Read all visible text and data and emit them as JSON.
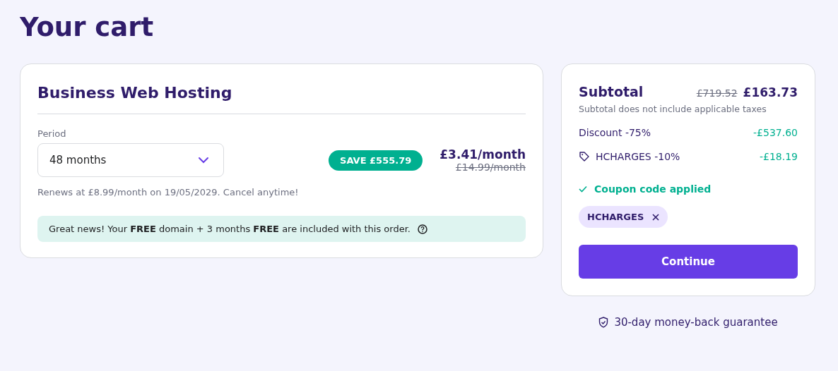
{
  "page_title": "Your cart",
  "product": {
    "name": "Business Web Hosting",
    "period_label": "Period",
    "period_value": "48 months",
    "save_badge": "SAVE £555.79",
    "price": "£3.41/month",
    "old_price": "£14.99/month",
    "renewal_note": "Renews at £8.99/month on 19/05/2029. Cancel anytime!",
    "promo_note": "Great news! Your **FREE** domain + 3 months **FREE** are included with this order."
  },
  "summary": {
    "title": "Subtotal",
    "old_total": "£719.52",
    "total": "£163.73",
    "tax_note": "Subtotal does not include applicable taxes",
    "lines": [
      {
        "kind": "discount",
        "label": "Discount -75%",
        "amount": "-£537.60"
      },
      {
        "kind": "coupon",
        "label": "HCHARGES -10%",
        "amount": "-£18.19"
      }
    ],
    "coupon_status": "Coupon code applied",
    "coupon_chip": "HCHARGES",
    "button": "Continue"
  },
  "guarantee": "30-day money-back guarantee"
}
